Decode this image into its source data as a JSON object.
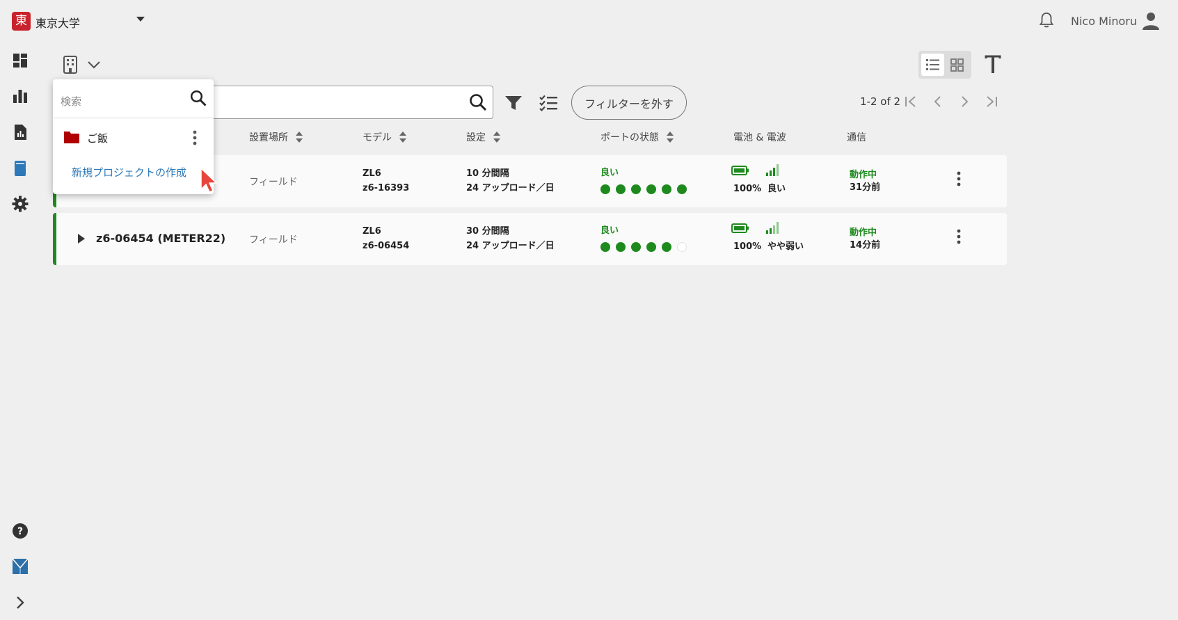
{
  "header": {
    "org_badge": "東",
    "org_name": "東京大学",
    "user_name": "Nico Minoru"
  },
  "sidebar": {
    "items": [
      {
        "icon": "dashboard-icon"
      },
      {
        "icon": "bar-chart-icon"
      },
      {
        "icon": "report-icon"
      },
      {
        "icon": "notebook-icon"
      },
      {
        "icon": "gear-icon"
      }
    ],
    "bottom": [
      {
        "icon": "help-icon"
      },
      {
        "icon": "brand-logo-icon"
      },
      {
        "icon": "chevron-right-icon"
      }
    ]
  },
  "toolbar": {
    "clear_filter_label": "フィルターを外す",
    "pager_text": "1-2 of 2"
  },
  "table": {
    "headers": [
      "設置場所",
      "モデル",
      "設定",
      "ポートの状態",
      "電池 & 電波",
      "通信"
    ],
    "rows": [
      {
        "name": "",
        "location": "フィールド",
        "model": "ZL6",
        "serial": "z6-16393",
        "interval": "10 分間隔",
        "uploads": "24 アップロード／日",
        "port_status": "良い",
        "port_dots": [
          1,
          1,
          1,
          1,
          1,
          1
        ],
        "battery": "100%",
        "signal": "良い",
        "comm_status": "動作中",
        "comm_time": "31分前"
      },
      {
        "name": "z6-06454 (METER22)",
        "location": "フィールド",
        "model": "ZL6",
        "serial": "z6-06454",
        "interval": "30 分間隔",
        "uploads": "24 アップロード／日",
        "port_status": "良い",
        "port_dots": [
          1,
          1,
          1,
          1,
          1,
          0
        ],
        "battery": "100%",
        "signal": "やや弱い",
        "comm_status": "動作中",
        "comm_time": "14分前"
      }
    ]
  },
  "popover": {
    "search_placeholder": "検索",
    "project_name": "ご飯",
    "new_project_label": "新規プロジェクトの作成"
  },
  "colors": {
    "accent_green": "#1e8a1e",
    "brand_red": "#c8232c",
    "link_blue": "#2c78b8",
    "folder_red": "#b00000"
  }
}
